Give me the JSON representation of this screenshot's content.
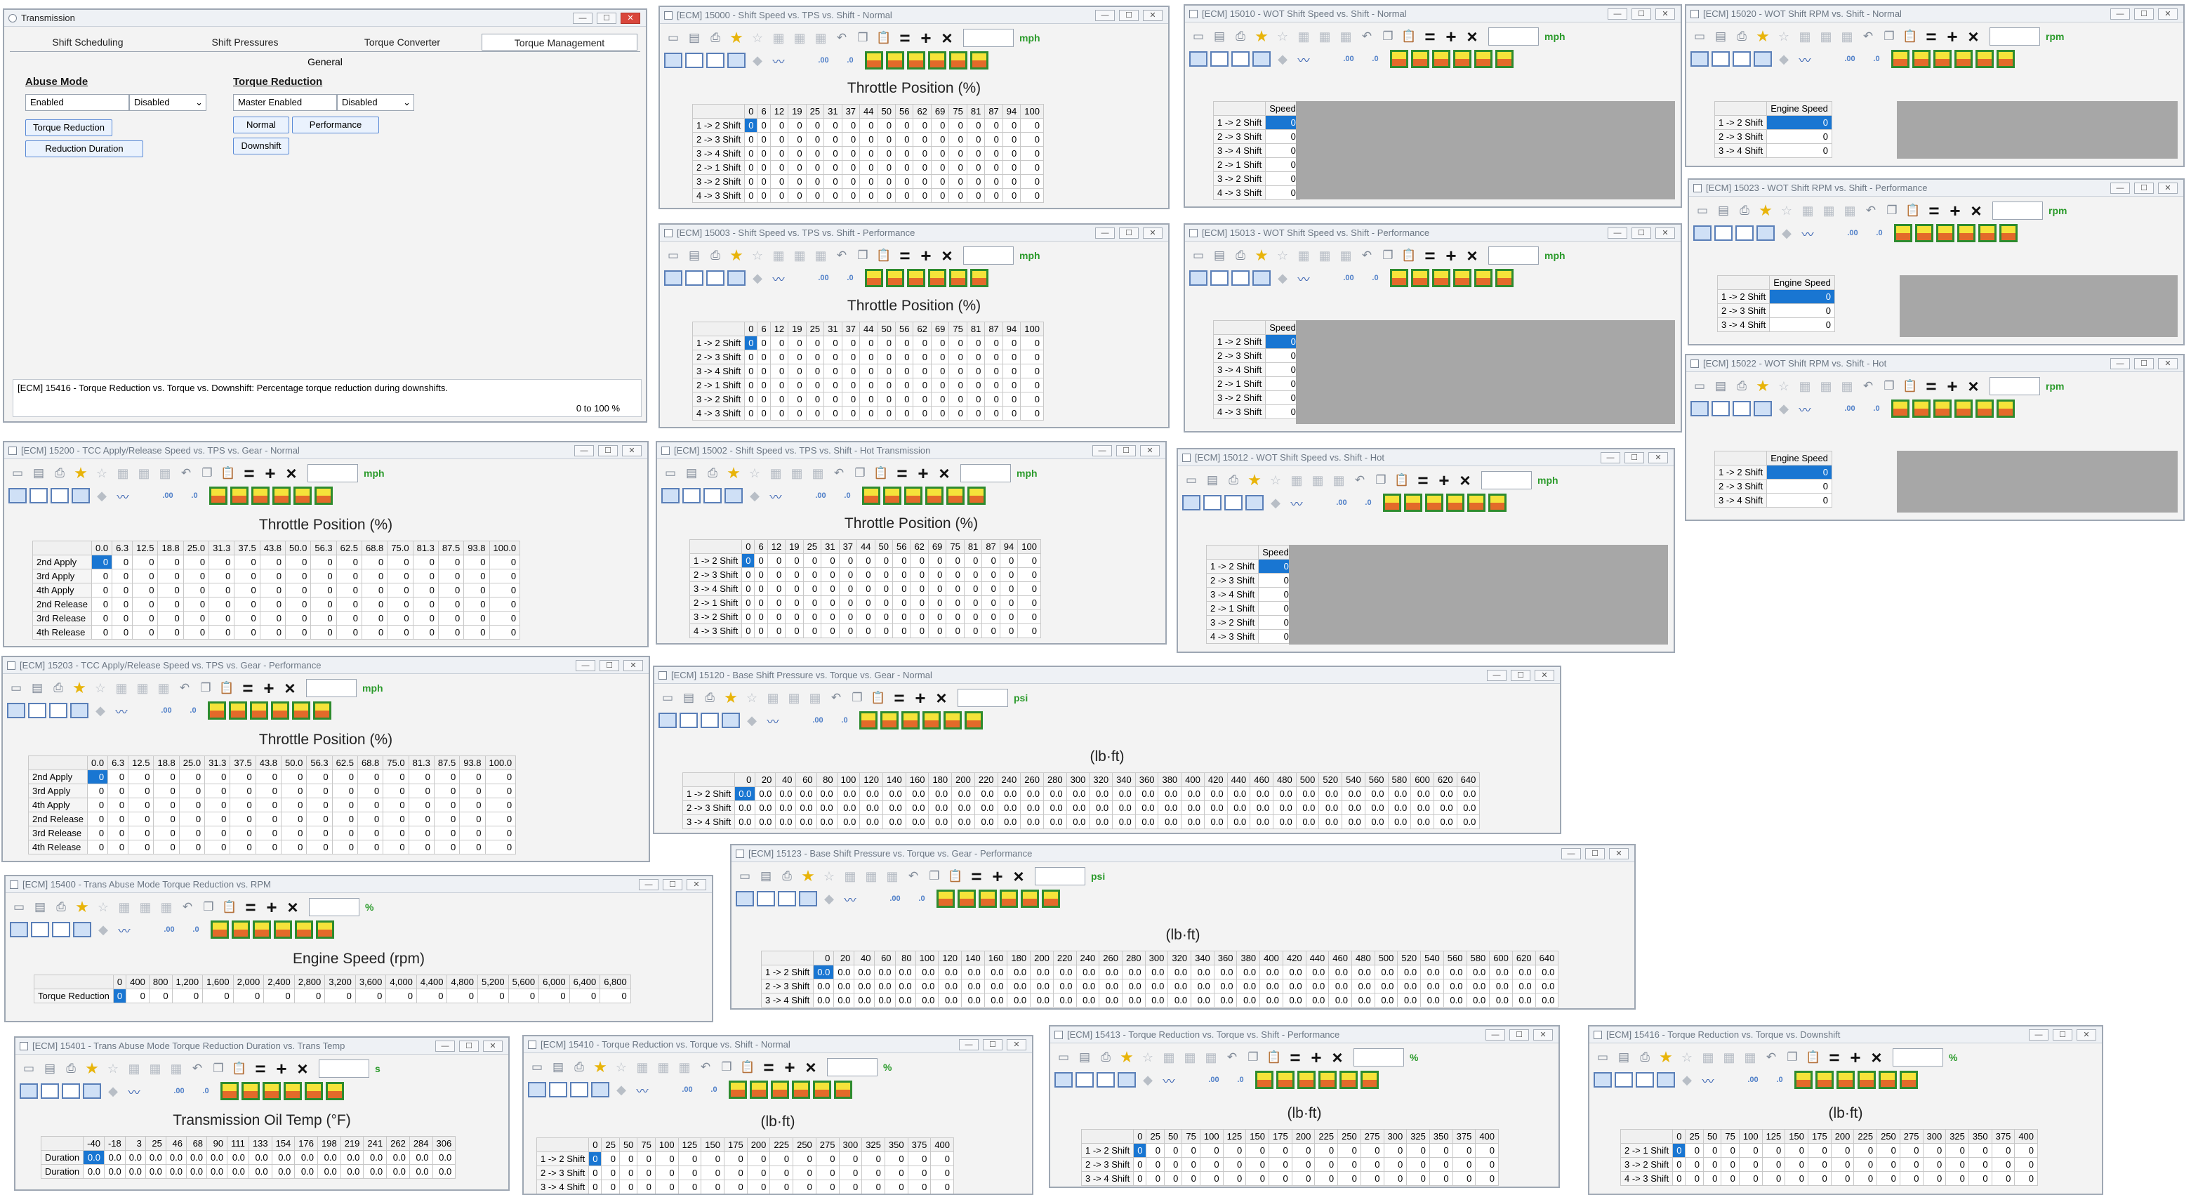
{
  "main": {
    "title": "Transmission",
    "tabs": [
      "Shift Scheduling",
      "Shift Pressures",
      "Torque Converter",
      "Torque Management"
    ],
    "general_label": "General",
    "abuse_heading": "Abuse Mode",
    "abuse_option1": "Enabled",
    "abuse_option2": "Disabled",
    "abuse_btn1": "Torque Reduction",
    "abuse_btn2": "Reduction Duration",
    "tr_heading": "Torque Reduction",
    "tr_option1": "Master Enabled",
    "tr_option2": "Disabled",
    "tr_btn_normal": "Normal",
    "tr_btn_perf": "Performance",
    "tr_btn_down": "Downshift",
    "description": "[ECM] 15416 - Torque Reduction vs. Torque vs. Downshift: Percentage torque reduction during downshifts.",
    "range": "0 to 100 %"
  },
  "icons": {
    "close": "close-icon",
    "maximize": "maximize-icon",
    "minimize": "minimize-icon",
    "favorite": "star-icon",
    "chart": "chart-icon"
  },
  "units": {
    "mph": "mph",
    "rpm": "rpm",
    "psi": "psi",
    "pct": "%",
    "sec": "s"
  },
  "axis": {
    "throttle": "Throttle Position (%)",
    "lbft": "(lb·ft)",
    "engine": "Engine Speed (rpm)",
    "oiltemp": "Transmission Oil Temp (°F)"
  },
  "cols": {
    "tps": [
      "0",
      "6",
      "12",
      "19",
      "25",
      "31",
      "37",
      "44",
      "50",
      "56",
      "62",
      "69",
      "75",
      "81",
      "87",
      "94",
      "100"
    ],
    "tcc": [
      "0.0",
      "6.3",
      "12.5",
      "18.8",
      "25.0",
      "31.3",
      "37.5",
      "43.8",
      "50.0",
      "56.3",
      "62.5",
      "68.8",
      "75.0",
      "81.3",
      "87.5",
      "93.8",
      "100.0"
    ],
    "press": [
      "0",
      "20",
      "40",
      "60",
      "80",
      "100",
      "120",
      "140",
      "160",
      "180",
      "200",
      "220",
      "240",
      "260",
      "280",
      "300",
      "320",
      "340",
      "360",
      "380",
      "400",
      "420",
      "440",
      "460",
      "480",
      "500",
      "520",
      "540",
      "560",
      "580",
      "600",
      "620",
      "640"
    ],
    "rpm": [
      "0",
      "400",
      "800",
      "1,200",
      "1,600",
      "2,000",
      "2,400",
      "2,800",
      "3,200",
      "3,600",
      "4,000",
      "4,400",
      "4,800",
      "5,200",
      "5,600",
      "6,000",
      "6,400",
      "6,800"
    ],
    "temp": [
      "-40",
      "-18",
      "3",
      "25",
      "46",
      "68",
      "90",
      "111",
      "133",
      "154",
      "176",
      "198",
      "219",
      "241",
      "262",
      "284",
      "306"
    ],
    "trq": [
      "0",
      "25",
      "50",
      "75",
      "100",
      "125",
      "150",
      "175",
      "200",
      "225",
      "250",
      "275",
      "300",
      "325",
      "350",
      "375",
      "400"
    ]
  },
  "rows": {
    "shift6": [
      "1 -> 2 Shift",
      "2 -> 3 Shift",
      "3 -> 4 Shift",
      "2 -> 1 Shift",
      "3 -> 2 Shift",
      "4 -> 3 Shift"
    ],
    "shift3": [
      "1 -> 2 Shift",
      "2 -> 3 Shift",
      "3 -> 4 Shift"
    ],
    "down3": [
      "2 -> 1 Shift",
      "3 -> 2 Shift",
      "4 -> 3 Shift"
    ],
    "tcc": [
      "2nd Apply",
      "3rd Apply",
      "4th Apply",
      "2nd Release",
      "3rd Release",
      "4th Release"
    ],
    "abuse": [
      "Torque Reduction"
    ],
    "dur": [
      "Duration",
      "Duration"
    ]
  },
  "hdr": {
    "speed": "Speed",
    "engine": "Engine Speed"
  },
  "windows": [
    {
      "title": "[ECM] 15000 - Shift Speed vs. TPS vs. Shift - Normal"
    },
    {
      "title": "[ECM] 15003 - Shift Speed vs. TPS vs. Shift - Performance"
    },
    {
      "title": "[ECM] 15002 - Shift Speed vs. TPS vs. Shift - Hot Transmission"
    },
    {
      "title": "[ECM] 15010 - WOT Shift Speed vs. Shift - Normal"
    },
    {
      "title": "[ECM] 15013 - WOT Shift Speed vs. Shift - Performance"
    },
    {
      "title": "[ECM] 15012 - WOT Shift Speed vs. Shift - Hot"
    },
    {
      "title": "[ECM] 15020 - WOT Shift RPM vs. Shift - Normal"
    },
    {
      "title": "[ECM] 15023 - WOT Shift RPM vs. Shift - Performance"
    },
    {
      "title": "[ECM] 15022 - WOT Shift RPM vs. Shift - Hot"
    },
    {
      "title": "[ECM] 15200 - TCC Apply/Release Speed vs. TPS vs. Gear - Normal"
    },
    {
      "title": "[ECM] 15203 - TCC Apply/Release Speed vs. TPS vs. Gear - Performance"
    },
    {
      "title": "[ECM] 15120 - Base Shift Pressure vs. Torque vs. Gear - Normal"
    },
    {
      "title": "[ECM] 15123 - Base Shift Pressure vs. Torque vs. Gear - Performance"
    },
    {
      "title": "[ECM] 15400 - Trans Abuse Mode Torque Reduction vs. RPM"
    },
    {
      "title": "[ECM] 15401 - Trans Abuse Mode Torque Reduction Duration vs. Trans Temp"
    },
    {
      "title": "[ECM] 15410 - Torque Reduction vs. Torque vs. Shift - Normal"
    },
    {
      "title": "[ECM] 15413 - Torque Reduction vs. Torque vs. Shift - Performance"
    },
    {
      "title": "[ECM] 15416 - Torque Reduction vs. Torque vs. Downshift"
    }
  ]
}
